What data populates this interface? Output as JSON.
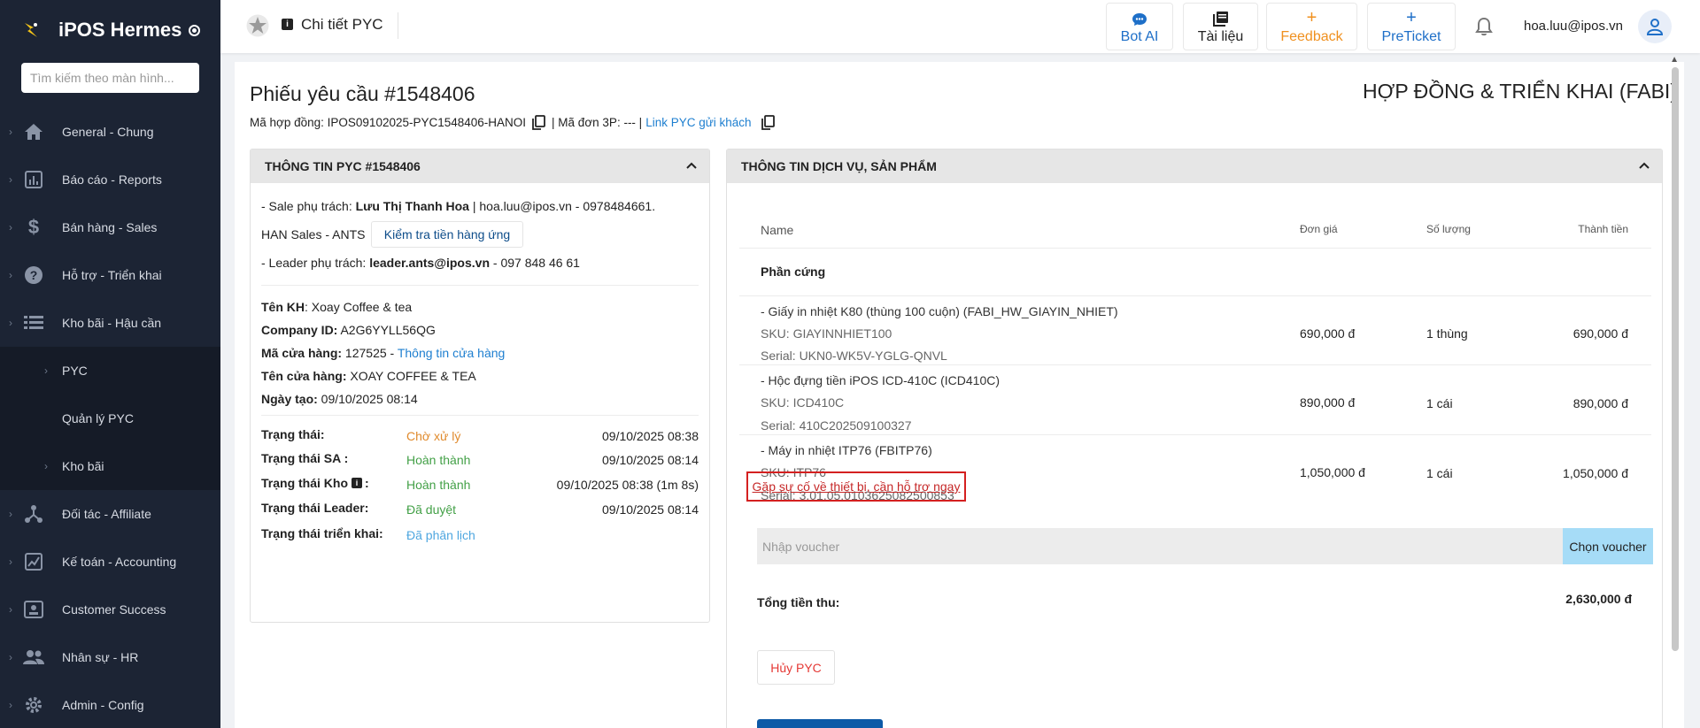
{
  "sidebar": {
    "brand": "iPOS Hermes",
    "search_placeholder": "Tìm kiếm theo màn hình...",
    "items": [
      {
        "label": "General - Chung"
      },
      {
        "label": "Báo cáo - Reports"
      },
      {
        "label": "Bán hàng - Sales"
      },
      {
        "label": "Hỗ trợ - Triển khai"
      },
      {
        "label": "Kho bãi - Hậu cần"
      }
    ],
    "sub_items": [
      {
        "label": "PYC"
      },
      {
        "label": "Quản lý PYC"
      },
      {
        "label": "Kho bãi"
      }
    ],
    "items_after": [
      {
        "label": "Đối tác - Affiliate"
      },
      {
        "label": "Kế toán - Accounting"
      },
      {
        "label": "Customer Success"
      },
      {
        "label": "Nhân sự - HR"
      },
      {
        "label": "Admin - Config"
      }
    ]
  },
  "header": {
    "title": "Chi tiết PYC",
    "buttons": {
      "bot_ai": "Bot AI",
      "docs": "Tài liệu",
      "feedback": "Feedback",
      "preticket": "PreTicket",
      "plus": "+"
    },
    "user_email": "hoa.luu@ipos.vn"
  },
  "page": {
    "title": "Phiếu yêu cầu #1548406",
    "contract_prefix": "Mã hợp đồng: IPOS09102025-PYC1548406-HANOI",
    "order3p": "| Mã đơn 3P: --- |",
    "link_label": "Link PYC gửi khách",
    "contract_type": "HỢP ĐỒNG & TRIỂN KHAI (FABI)"
  },
  "left_panel": {
    "title": "THÔNG TIN PYC #1548406",
    "sale_prefix": "- Sale phụ trách: ",
    "sale_name": "Lưu Thị Thanh Hoa",
    "sale_contact": " | hoa.luu@ipos.vn - 0978484661.",
    "team": "HAN Sales - ANTS",
    "check_debt_btn": "Kiểm tra tiền hàng ứng",
    "leader_prefix": "- Leader phụ trách: ",
    "leader_email": "leader.ants@ipos.vn",
    "leader_phone": " - 097 848 46 61",
    "customer_label": "Tên KH",
    "customer_value": ": Xoay Coffee & tea",
    "company_label": "Company ID:",
    "company_value": " A2G6YYLL56QG",
    "store_code_label": "Mã cửa hàng:",
    "store_code_value": " 127525 - ",
    "store_info_link": "Thông tin cửa hàng",
    "store_name_label": "Tên cửa hàng:",
    "store_name_value": " XOAY COFFEE & TEA",
    "created_label": "Ngày tạo:",
    "created_value": " 09/10/2025 08:14",
    "statuses": [
      {
        "label": "Trạng thái:",
        "value": "Chờ xử lý",
        "time": "09/10/2025 08:38",
        "color": "#e08a2c"
      },
      {
        "label": "Trạng thái SA :",
        "value": "Hoàn thành",
        "time": "09/10/2025 08:14",
        "color": "#43a047"
      },
      {
        "label": "Trạng thái Kho",
        "value": "Hoàn thành",
        "time": "09/10/2025 08:38 (1m 8s)",
        "color": "#43a047",
        "info_icon": "i",
        "suffix": ":"
      },
      {
        "label": "Trạng thái Leader:",
        "value": "Đã duyệt",
        "time": "09/10/2025 08:14",
        "color": "#43a047"
      },
      {
        "label": "Trạng thái triển khai:",
        "value": "Đã phân lịch",
        "time": "",
        "color": "#4fa7e0"
      }
    ]
  },
  "right_panel": {
    "title": "THÔNG TIN DỊCH VỤ, SẢN PHẨM",
    "columns": {
      "name": "Name",
      "price": "Đơn giá",
      "qty": "Số lượng",
      "total": "Thành tiền"
    },
    "group": "Phần cứng",
    "products": [
      {
        "name": "- Giấy in nhiệt K80 (thùng 100 cuộn) (FABI_HW_GIAYIN_NHIET)",
        "sku": "SKU: GIAYINNHIET100",
        "serial": "Serial: UKN0-WK5V-YGLG-QNVL",
        "price": "690,000 đ",
        "qty": "1 thùng",
        "total": "690,000 đ"
      },
      {
        "name": "- Hộc đựng tiền iPOS ICD-410C (ICD410C)",
        "sku": "SKU: ICD410C",
        "serial": "Serial: 410C202509100327",
        "price": "890,000 đ",
        "qty": "1 cái",
        "total": "890,000 đ"
      },
      {
        "name": "- Máy in nhiệt ITP76 (FBITP76)",
        "sku": "SKU: ITP76",
        "serial": "Serial: 3.01.05.0103625082500853",
        "price": "1,050,000 đ",
        "qty": "1 cái",
        "total": "1,050,000 đ"
      }
    ],
    "support_link": "Gặp sự cố về thiết bị, cần hỗ trợ ngay",
    "voucher_placeholder": "Nhập voucher",
    "voucher_btn": "Chọn voucher",
    "total_label": "Tổng tiền thu:",
    "total_value": "2,630,000 đ",
    "cancel_btn": "Hủy PYC"
  },
  "colors": {
    "sidebar_bg": "#1c2434",
    "link": "#1e7fd0",
    "header_accent": "#0d5aa7",
    "feedback": "#f0901e",
    "danger": "#d42020"
  }
}
